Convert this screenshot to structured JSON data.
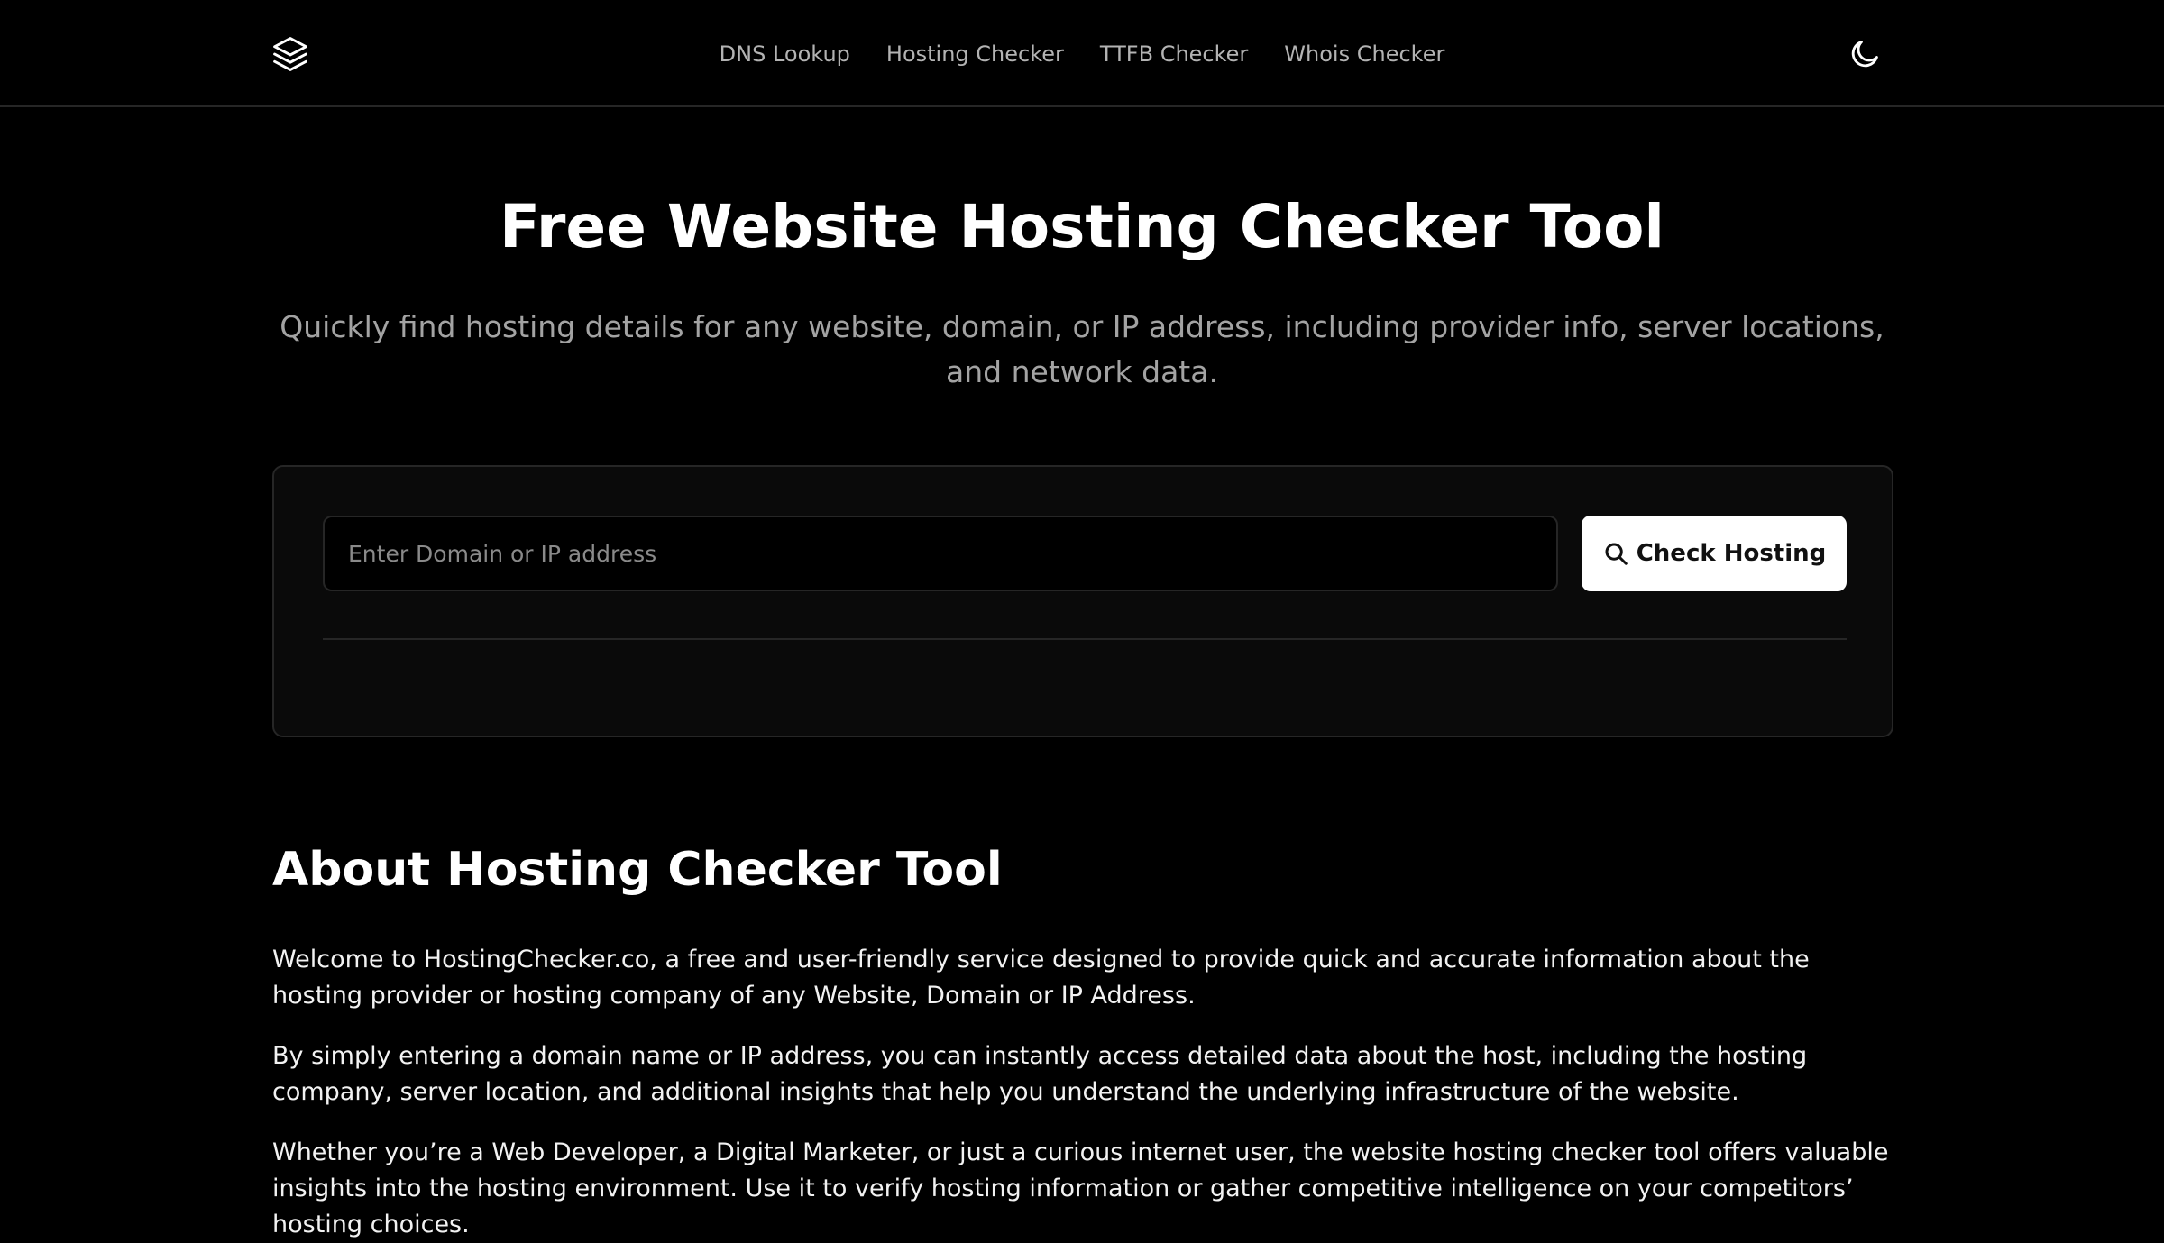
{
  "header": {
    "logo_icon": "layers-icon",
    "nav": [
      {
        "label": "DNS Lookup"
      },
      {
        "label": "Hosting Checker"
      },
      {
        "label": "TTFB Checker"
      },
      {
        "label": "Whois Checker"
      }
    ],
    "theme_icon": "moon-icon"
  },
  "hero": {
    "title": "Free Website Hosting Checker Tool",
    "subtitle": "Quickly find hosting details for any website, domain, or IP address, including provider info, server locations, and network data."
  },
  "search": {
    "placeholder": "Enter Domain or IP address",
    "value": "",
    "button_label": "Check Hosting",
    "button_icon": "search-icon"
  },
  "about": {
    "title": "About Hosting Checker Tool",
    "paragraphs": [
      "Welcome to HostingChecker.co, a free and user-friendly service designed to provide quick and accurate information about the hosting provider or hosting company of any Website, Domain or IP Address.",
      "By simply entering a domain name or IP address, you can instantly access detailed data about the host, including the hosting company, server location, and additional insights that help you understand the underlying infrastructure of the website.",
      "Whether you’re a Web Developer, a Digital Marketer, or just a curious internet user, the website hosting checker tool offers valuable insights into the hosting environment. Use it to verify hosting information or gather competitive intelligence on your competitors’ hosting choices."
    ]
  },
  "colors": {
    "background": "#000000",
    "card": "#0a0a0a",
    "border": "#262626",
    "muted_text": "#a3a3a3",
    "button_bg": "#ffffff"
  }
}
